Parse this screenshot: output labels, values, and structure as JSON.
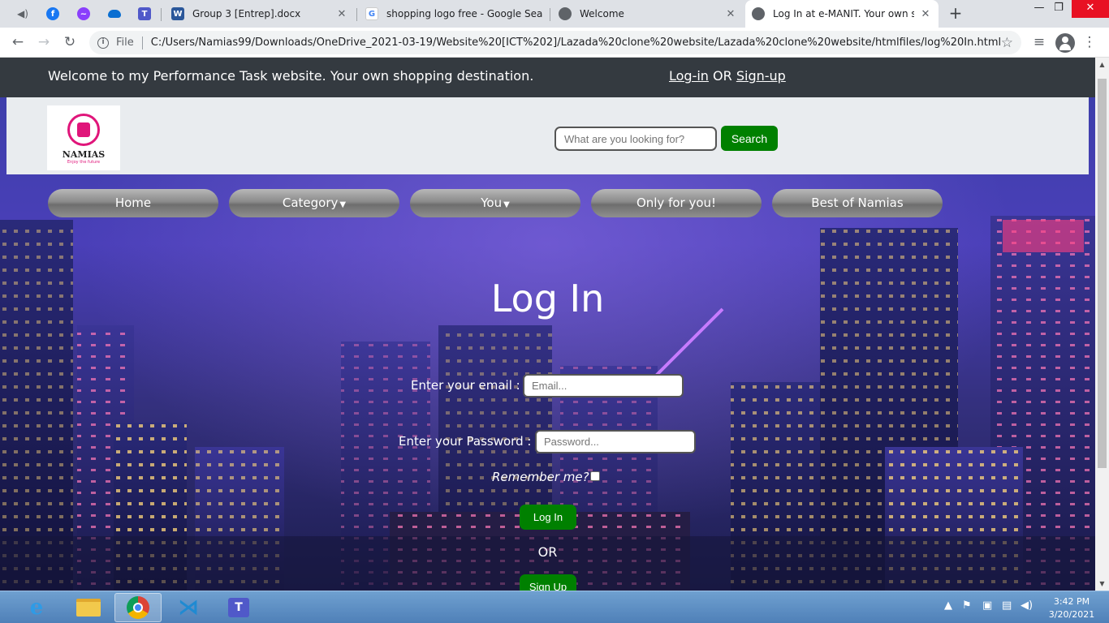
{
  "browser": {
    "pinned_tabs": [
      {
        "icon": "speaker-icon"
      },
      {
        "icon": "facebook-icon"
      },
      {
        "icon": "messenger-icon"
      },
      {
        "icon": "onedrive-icon"
      },
      {
        "icon": "teams-icon"
      }
    ],
    "tabs": [
      {
        "title": "Group 3 [Entrep].docx",
        "icon": "word-icon"
      },
      {
        "title": "shopping logo free - Google Sea",
        "icon": "google-icon"
      },
      {
        "title": "Welcome",
        "icon": "globe-icon"
      },
      {
        "title": "Log In at e-MANIT. Your own sho",
        "icon": "globe-icon",
        "active": true
      }
    ],
    "address": {
      "scheme_label": "File",
      "url": "C:/Users/Namias99/Downloads/OneDrive_2021-03-19/Website%20[ICT%202]/Lazada%20clone%20website/Lazada%20clone%20website/htmlfiles/log%20In.html"
    }
  },
  "page": {
    "welcome_bar": {
      "message": "Welcome to my Performance Task website. Your own shopping destination.",
      "login_link": "Log-in",
      "or": "OR",
      "signup_link": "Sign-up"
    },
    "header": {
      "logo_name": "NAMIAS",
      "logo_tagline": "Enjoy the future",
      "search_placeholder": "What are you looking for?",
      "search_button": "Search"
    },
    "nav": [
      {
        "label": "Home",
        "dropdown": false
      },
      {
        "label": "Category",
        "dropdown": true
      },
      {
        "label": "You",
        "dropdown": true
      },
      {
        "label": "Only for you!",
        "dropdown": false
      },
      {
        "label": "Best of Namias",
        "dropdown": false
      }
    ],
    "login_form": {
      "title": "Log In",
      "email_label": "Enter your email :",
      "email_placeholder": "Email...",
      "password_label": "Enter your Password :",
      "password_placeholder": "Password...",
      "remember_label": "Remember me?",
      "remember_checked": false,
      "login_button": "Log In",
      "or_text": "OR",
      "signup_button": "Sign Up"
    }
  },
  "taskbar": {
    "apps": [
      "internet-explorer-icon",
      "file-explorer-icon",
      "chrome-icon",
      "vscode-icon",
      "teams-icon"
    ],
    "clock": {
      "time": "3:42 PM",
      "date": "3/20/2021"
    }
  },
  "colors": {
    "accent_green": "#008000",
    "dark_bar": "#343a40",
    "header_bg": "#e9ecef",
    "logo_pink": "#e0157a"
  }
}
